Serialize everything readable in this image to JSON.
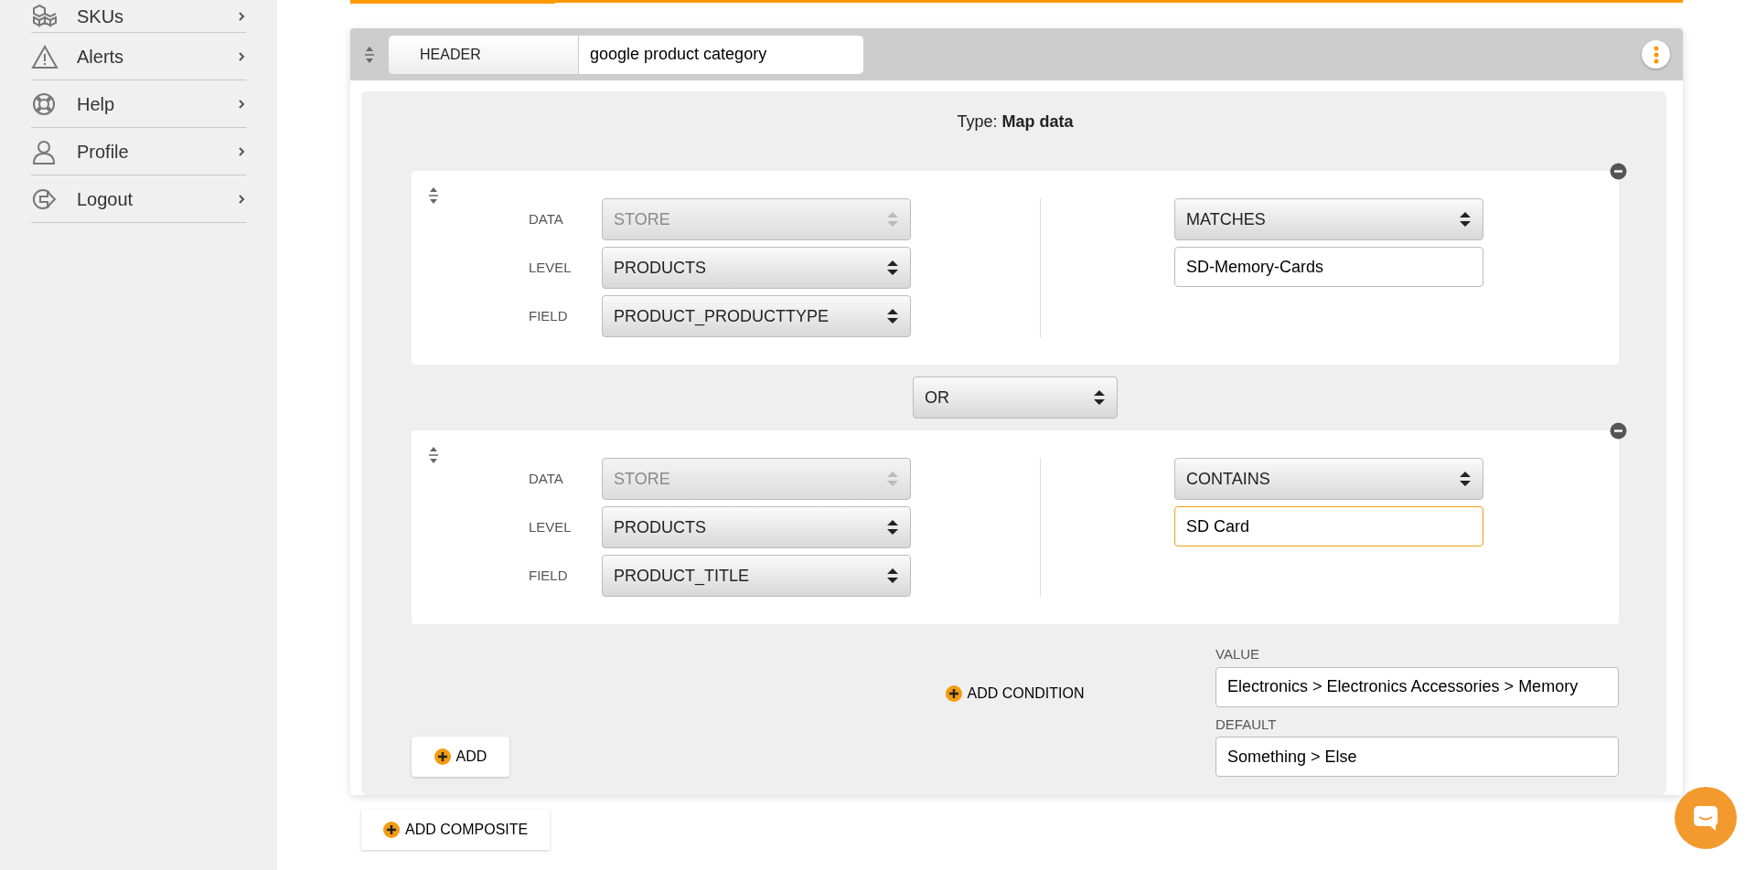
{
  "sidebar": {
    "items": [
      {
        "label": "SKUs"
      },
      {
        "label": "Alerts"
      },
      {
        "label": "Help"
      },
      {
        "label": "Profile"
      },
      {
        "label": "Logout"
      }
    ]
  },
  "header": {
    "label": "HEADER",
    "value": "google product category"
  },
  "type_line": "Type: **Map data**",
  "conditions": [
    {
      "fields": [
        {
          "label": "DATA",
          "value": "STORE",
          "disabled": true
        },
        {
          "label": "LEVEL",
          "value": "PRODUCTS",
          "disabled": false
        },
        {
          "label": "FIELD",
          "value": "PRODUCT_PRODUCTTYPE",
          "disabled": false
        }
      ],
      "operator": "MATCHES",
      "value": "SD-Memory-Cards",
      "focused": false
    },
    {
      "fields": [
        {
          "label": "DATA",
          "value": "STORE",
          "disabled": true
        },
        {
          "label": "LEVEL",
          "value": "PRODUCTS",
          "disabled": false
        },
        {
          "label": "FIELD",
          "value": "PRODUCT_TITLE",
          "disabled": false
        }
      ],
      "operator": "CONTAINS",
      "value": "SD Card",
      "focused": true
    }
  ],
  "joiner": "OR",
  "add_condition": "ADD CONDITION",
  "value_field": {
    "label": "VALUE",
    "value": "Electronics > Electronics Accessories > Memory"
  },
  "default_field": {
    "label": "DEFAULT",
    "value": "Something > Else"
  },
  "add_button": "ADD",
  "add_composite": "ADD COMPOSITE"
}
